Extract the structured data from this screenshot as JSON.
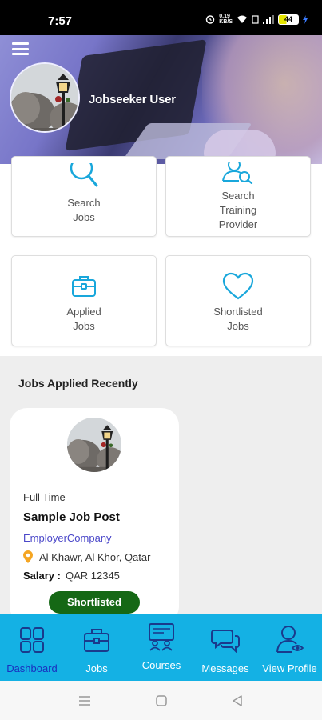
{
  "status_bar": {
    "time": "7:57",
    "speed_value": "0.19",
    "speed_unit": "KB/S",
    "battery": "44"
  },
  "header": {
    "user_name": "Jobseeker User"
  },
  "tiles": [
    {
      "line1": "Search",
      "line2": "Jobs",
      "line3": ""
    },
    {
      "line1": "Search",
      "line2": "Training",
      "line3": "Provider"
    },
    {
      "line1": "Applied",
      "line2": "Jobs",
      "line3": ""
    },
    {
      "line1": "Shortlisted",
      "line2": "Jobs",
      "line3": ""
    }
  ],
  "recent": {
    "title": "Jobs Applied Recently",
    "job": {
      "type": "Full Time",
      "title": "Sample Job Post",
      "company": "EmployerCompany",
      "location": "Al Khawr, Al Khor, Qatar",
      "salary_label": "Salary :",
      "salary_value": "QAR 12345",
      "status": "Shortlisted"
    }
  },
  "bottom_nav": [
    {
      "label": "Dashboard",
      "icon": "grid-icon",
      "active": true
    },
    {
      "label": "Jobs",
      "icon": "briefcase-icon",
      "active": false
    },
    {
      "label": "Courses",
      "icon": "courses-icon",
      "active": false
    },
    {
      "label": "Messages",
      "icon": "chat-icon",
      "active": false
    },
    {
      "label": "View Profile",
      "icon": "profile-icon",
      "active": false
    }
  ],
  "colors": {
    "accent": "#14b1e4",
    "active_nav_label": "#1a2fbf",
    "company_link": "#4a47c9",
    "badge": "#156815",
    "location_pin": "#f5a623"
  }
}
